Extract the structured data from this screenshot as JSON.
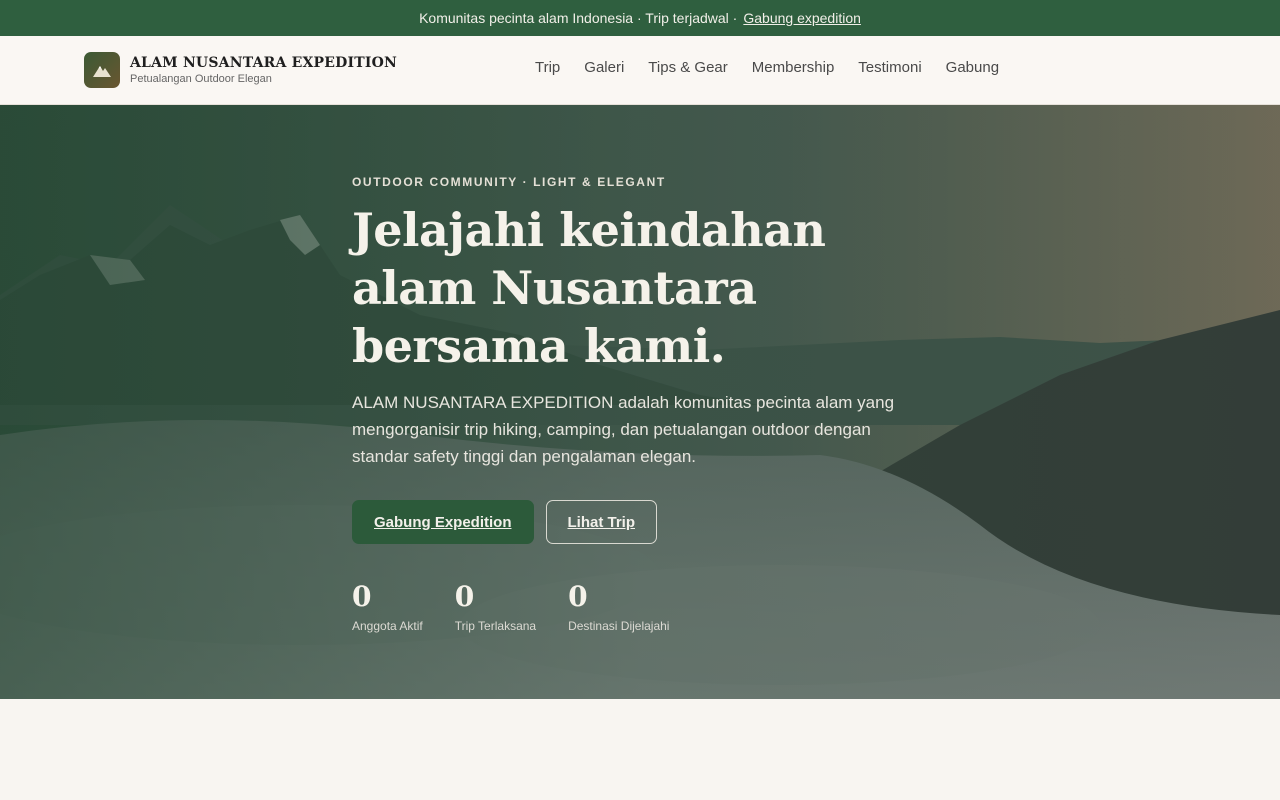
{
  "topbar": {
    "text": "Komunitas pecinta alam Indonesia · Trip terjadwal ·",
    "link": "Gabung expedition"
  },
  "brand": {
    "name": "ALAM NUSANTARA EXPEDITION",
    "tagline": "Petualangan Outdoor Elegan"
  },
  "nav": {
    "items": [
      "Trip",
      "Galeri",
      "Tips & Gear",
      "Membership",
      "Testimoni",
      "Gabung"
    ]
  },
  "hero": {
    "eyebrow": "OUTDOOR COMMUNITY · LIGHT & ELEGANT",
    "title": "Jelajahi keindahan alam Nusantara bersama kami.",
    "description": "ALAM NUSANTARA EXPEDITION adalah komunitas pecinta alam yang mengorganisir trip hiking, camping, dan petualangan outdoor dengan standar safety tinggi dan pengalaman elegan.",
    "primary_button": "Gabung Expedition",
    "secondary_button": "Lihat Trip",
    "stats": [
      {
        "value": "0",
        "label": "Anggota Aktif"
      },
      {
        "value": "0",
        "label": "Trip Terlaksana"
      },
      {
        "value": "0",
        "label": "Destinasi Dijelajahi"
      }
    ]
  },
  "colors": {
    "brand_green": "#2f5f3f",
    "button_green": "#2c5a3a",
    "page_background": "#f8f5f1"
  },
  "icons": {
    "logo": "mountain-icon"
  }
}
